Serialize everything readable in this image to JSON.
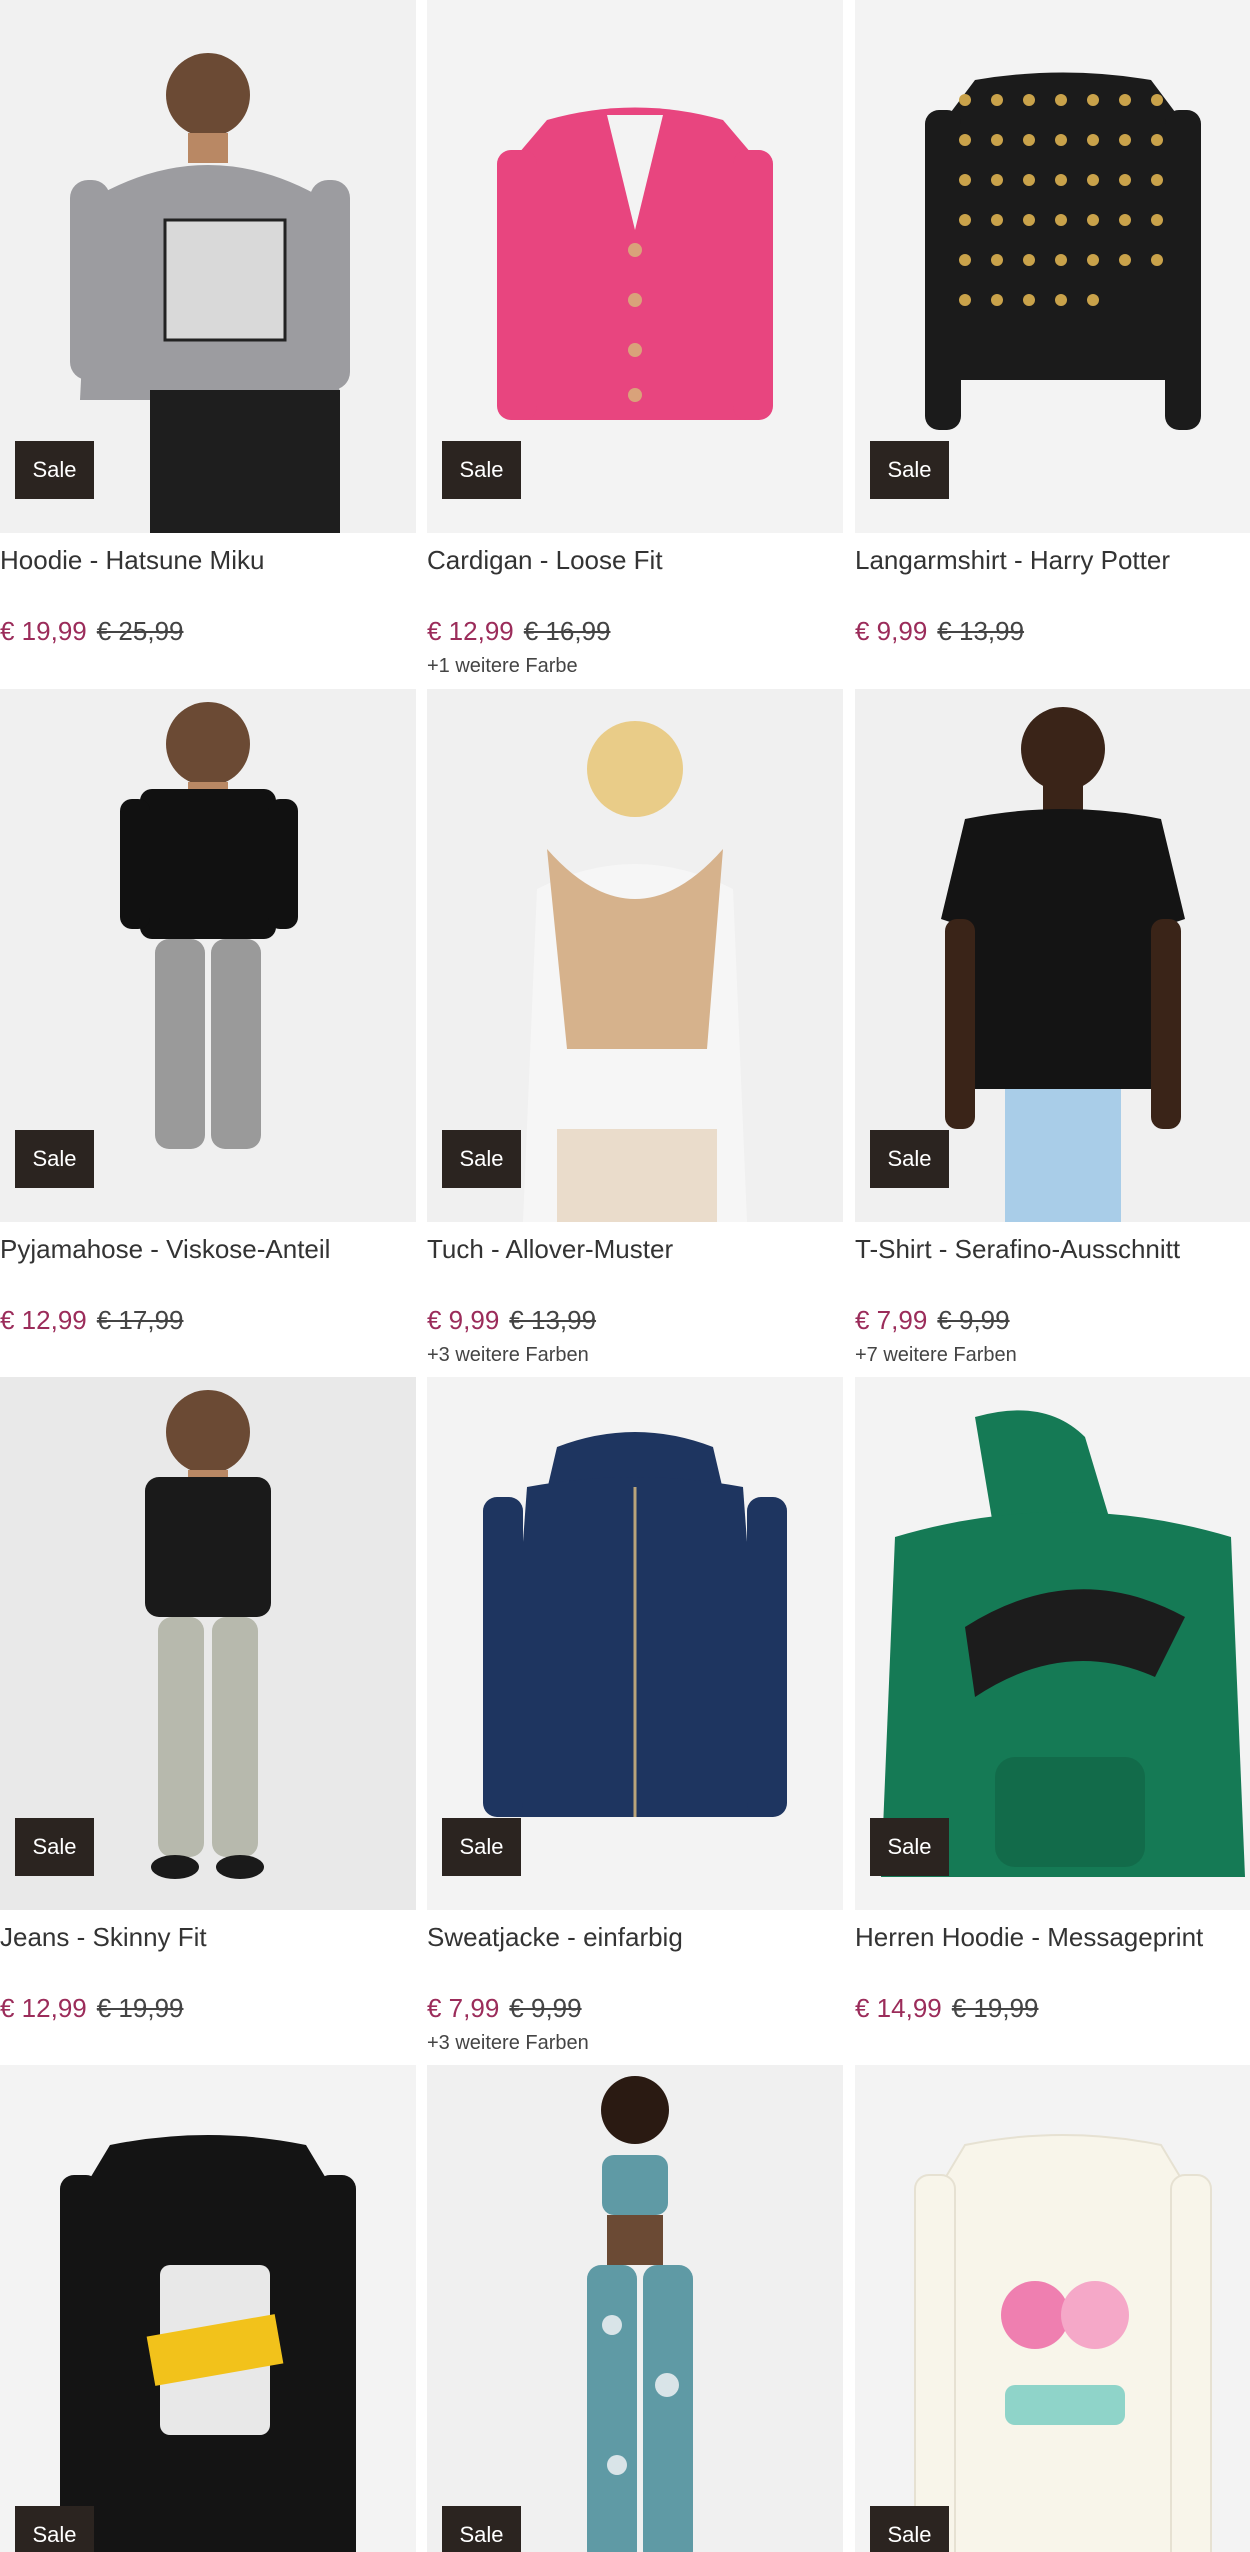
{
  "sale_label": "Sale",
  "products": [
    {
      "title": "Hoodie - Hatsune Miku",
      "price": "€ 19,99",
      "old_price": "€ 25,99",
      "colors": "",
      "image": "model-grey-hoodie",
      "img_colors": {
        "bg": "#f1f1f1",
        "main": "#9c9ca0",
        "accent": "#1e1e1e"
      }
    },
    {
      "title": "Cardigan - Loose Fit",
      "price": "€ 12,99",
      "old_price": "€ 16,99",
      "colors": "+1 weitere Farbe",
      "image": "pink-cardigan",
      "img_colors": {
        "bg": "#f3f3f3",
        "main": "#e8457f",
        "accent": "#d9a27a"
      }
    },
    {
      "title": "Langarmshirt - Harry Potter",
      "price": "€ 9,99",
      "old_price": "€ 13,99",
      "colors": "",
      "image": "black-gold-longsleeve",
      "img_colors": {
        "bg": "#f3f3f3",
        "main": "#1b1b1b",
        "accent": "#c9a24a"
      }
    },
    {
      "title": "Pyjamahose - Viskose-Anteil",
      "price": "€ 12,99",
      "old_price": "€ 17,99",
      "colors": "",
      "image": "model-grey-pants",
      "img_colors": {
        "bg": "#f0f0f0",
        "main": "#9a9a9a",
        "accent": "#111111"
      }
    },
    {
      "title": "Tuch - Allover-Muster",
      "price": "€ 9,99",
      "old_price": "€ 13,99",
      "colors": "+3 weitere Farben",
      "image": "model-scarf",
      "img_colors": {
        "bg": "#f0f0f0",
        "main": "#d6b28c",
        "accent": "#f6f6f6"
      }
    },
    {
      "title": "T-Shirt - Serafino-Ausschnitt",
      "price": "€ 7,99",
      "old_price": "€ 9,99",
      "colors": "+7 weitere Farben",
      "image": "model-black-tshirt",
      "img_colors": {
        "bg": "#f0f0f0",
        "main": "#141414",
        "accent": "#a9cde8"
      }
    },
    {
      "title": "Jeans - Skinny Fit",
      "price": "€ 12,99",
      "old_price": "€ 19,99",
      "colors": "",
      "image": "model-skinny-jeans",
      "img_colors": {
        "bg": "#e9e9e9",
        "main": "#b7b9ad",
        "accent": "#1a1a1a"
      }
    },
    {
      "title": "Sweatjacke - einfarbig",
      "price": "€ 7,99",
      "old_price": "€ 9,99",
      "colors": "+3 weitere Farben",
      "image": "navy-zip-hoodie",
      "img_colors": {
        "bg": "#f3f3f3",
        "main": "#1e3560",
        "accent": "#b9a47a"
      }
    },
    {
      "title": "Herren Hoodie - Messageprint",
      "price": "€ 14,99",
      "old_price": "€ 19,99",
      "colors": "",
      "image": "green-hoodie",
      "img_colors": {
        "bg": "#f3f3f3",
        "main": "#157a55",
        "accent": "#1c1c1c"
      }
    },
    {
      "title": "",
      "price": "",
      "old_price": "",
      "colors": "",
      "image": "black-print-longsleeve",
      "img_colors": {
        "bg": "#f3f3f3",
        "main": "#141414",
        "accent": "#f2c21b"
      }
    },
    {
      "title": "",
      "price": "",
      "old_price": "",
      "colors": "",
      "image": "model-sport-set",
      "img_colors": {
        "bg": "#f0f0f0",
        "main": "#5f9aa5",
        "accent": "#d9e4e8"
      }
    },
    {
      "title": "",
      "price": "",
      "old_price": "",
      "colors": "",
      "image": "cream-carebears-longsleeve",
      "img_colors": {
        "bg": "#f3f3f3",
        "main": "#f8f5ea",
        "accent": "#ef7fb0"
      }
    }
  ]
}
